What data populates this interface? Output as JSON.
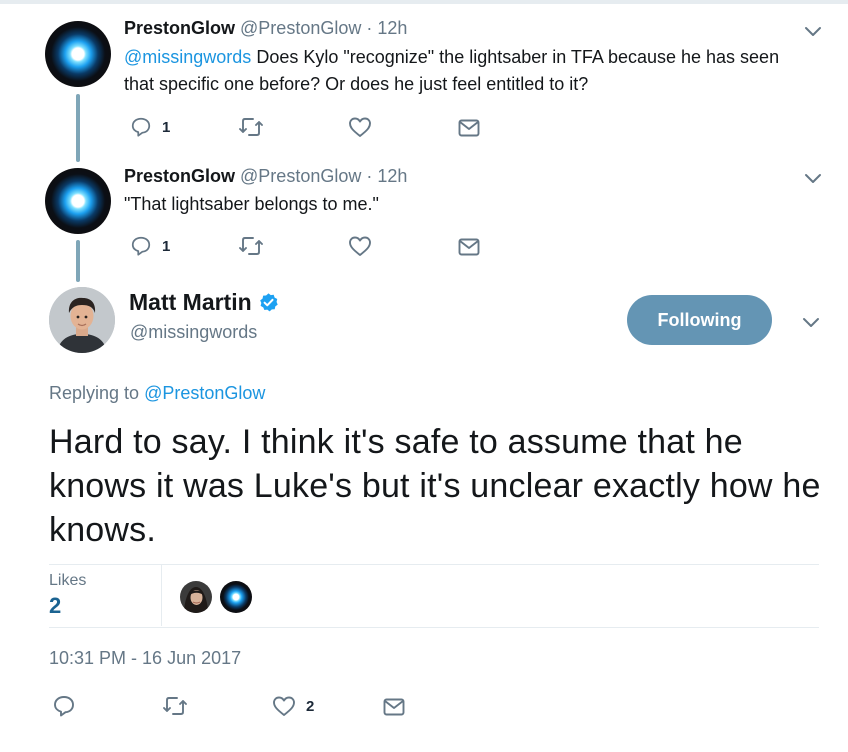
{
  "thread": [
    {
      "author_name": "PrestonGlow",
      "author_handle": "@PrestonGlow",
      "separator": "·",
      "time": "12h",
      "mention": "@missingwords",
      "text_after_mention": " Does Kylo \"recognize\" the lightsaber in TFA because he has seen that specific one before? Or does he just feel entitled to it?",
      "reply_count": "1"
    },
    {
      "author_name": "PrestonGlow",
      "author_handle": "@PrestonGlow",
      "separator": "·",
      "time": "12h",
      "text": "\"That lightsaber belongs to me.\"",
      "reply_count": "1"
    }
  ],
  "main_tweet": {
    "author_name": "Matt Martin",
    "author_handle": "@missingwords",
    "verified": true,
    "follow_label": "Following",
    "replying_prefix": "Replying to ",
    "replying_to": "@PrestonGlow",
    "text": "Hard to say. I think it's safe to assume that he knows it was Luke's but it's unclear exactly how he knows.",
    "likes_label": "Likes",
    "likes_count": "2",
    "timestamp": "10:31 PM - 16 Jun 2017",
    "like_action_count": "2"
  },
  "colors": {
    "accent": "#1b95e0",
    "follow_button": "#6495b4",
    "muted_text": "#657786",
    "thread_line": "#7fa6b8"
  },
  "icons": [
    "reply-icon",
    "retweet-icon",
    "like-icon",
    "direct-message-icon",
    "chevron-down-icon",
    "verified-badge-icon"
  ]
}
